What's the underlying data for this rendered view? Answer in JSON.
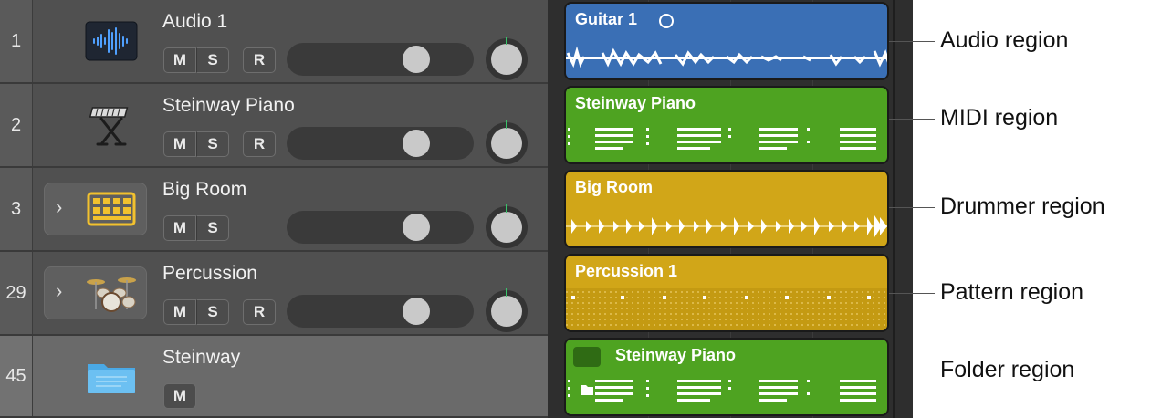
{
  "tracks": [
    {
      "number": "1",
      "name": "Audio 1",
      "m": "M",
      "s": "S",
      "r": "R"
    },
    {
      "number": "2",
      "name": "Steinway Piano",
      "m": "M",
      "s": "S",
      "r": "R"
    },
    {
      "number": "3",
      "name": "Big Room",
      "m": "M",
      "s": "S"
    },
    {
      "number": "29",
      "name": "Percussion",
      "m": "M",
      "s": "S",
      "r": "R"
    },
    {
      "number": "45",
      "name": "Steinway",
      "m": "M"
    }
  ],
  "regions": [
    {
      "title": "Guitar 1",
      "color": "#3a6fb5"
    },
    {
      "title": "Steinway Piano",
      "color": "#4ea321"
    },
    {
      "title": "Big Room",
      "color": "#d1a618"
    },
    {
      "title": "Percussion 1",
      "color": "#d1a618"
    },
    {
      "title": "Steinway Piano",
      "color": "#4ea321"
    }
  ],
  "callouts": [
    {
      "label": "Audio region"
    },
    {
      "label": "MIDI region"
    },
    {
      "label": "Drummer region"
    },
    {
      "label": "Pattern region"
    },
    {
      "label": "Folder region"
    }
  ],
  "icons": {
    "track1": "waveform-icon",
    "track2": "keyboard-stand-icon",
    "track3": "drum-machine-icon",
    "track4": "drum-kit-icon",
    "track5": "folder-icon"
  }
}
